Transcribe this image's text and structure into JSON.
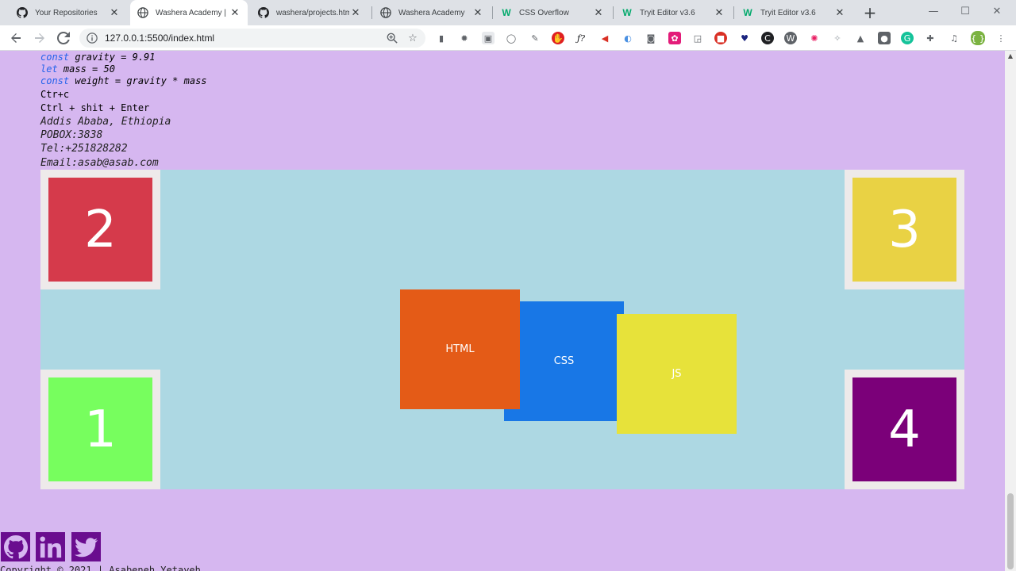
{
  "tabs": [
    {
      "title": "Your Repositories",
      "icon": "github-icon",
      "active": false
    },
    {
      "title": "Washera Academy | Sta",
      "icon": "globe-icon",
      "active": true
    },
    {
      "title": "washera/projects.html a",
      "icon": "github-icon",
      "active": false
    },
    {
      "title": "Washera Academy",
      "icon": "globe-icon",
      "active": false
    },
    {
      "title": "CSS Overflow",
      "icon": "w3schools-icon",
      "active": false
    },
    {
      "title": "Tryit Editor v3.6",
      "icon": "w3schools-icon",
      "active": false
    },
    {
      "title": "Tryit Editor v3.6",
      "icon": "w3schools-icon",
      "active": false
    }
  ],
  "toolbar": {
    "url": "127.0.0.1:5500/index.html"
  },
  "code_lines": [
    {
      "kw": "const",
      "rest": " gravity = 9.91"
    },
    {
      "kw": "let",
      "rest": " mass = 50"
    },
    {
      "kw": "const",
      "rest": " weight = gravity * mass"
    }
  ],
  "shortcuts": [
    "Ctr+c",
    "Ctrl + shit + Enter"
  ],
  "address": [
    "Addis Ababa, Ethiopia",
    "POBOX:3838",
    "Tel:+251828282",
    "Email:asab@asab.com"
  ],
  "corners": [
    {
      "label": "2",
      "color": "#d53a4b"
    },
    {
      "label": "3",
      "color": "#e9d244"
    },
    {
      "label": "1",
      "color": "#77fe5e"
    },
    {
      "label": "4",
      "color": "#7b0079"
    }
  ],
  "langs": [
    {
      "label": "HTML",
      "color": "#e45b17"
    },
    {
      "label": "CSS",
      "color": "#1877e6"
    },
    {
      "label": "JS",
      "color": "#e7e23a"
    }
  ],
  "footer": {
    "copyright": "Copyright © 2021 | Asabeneh Yetayeh"
  }
}
